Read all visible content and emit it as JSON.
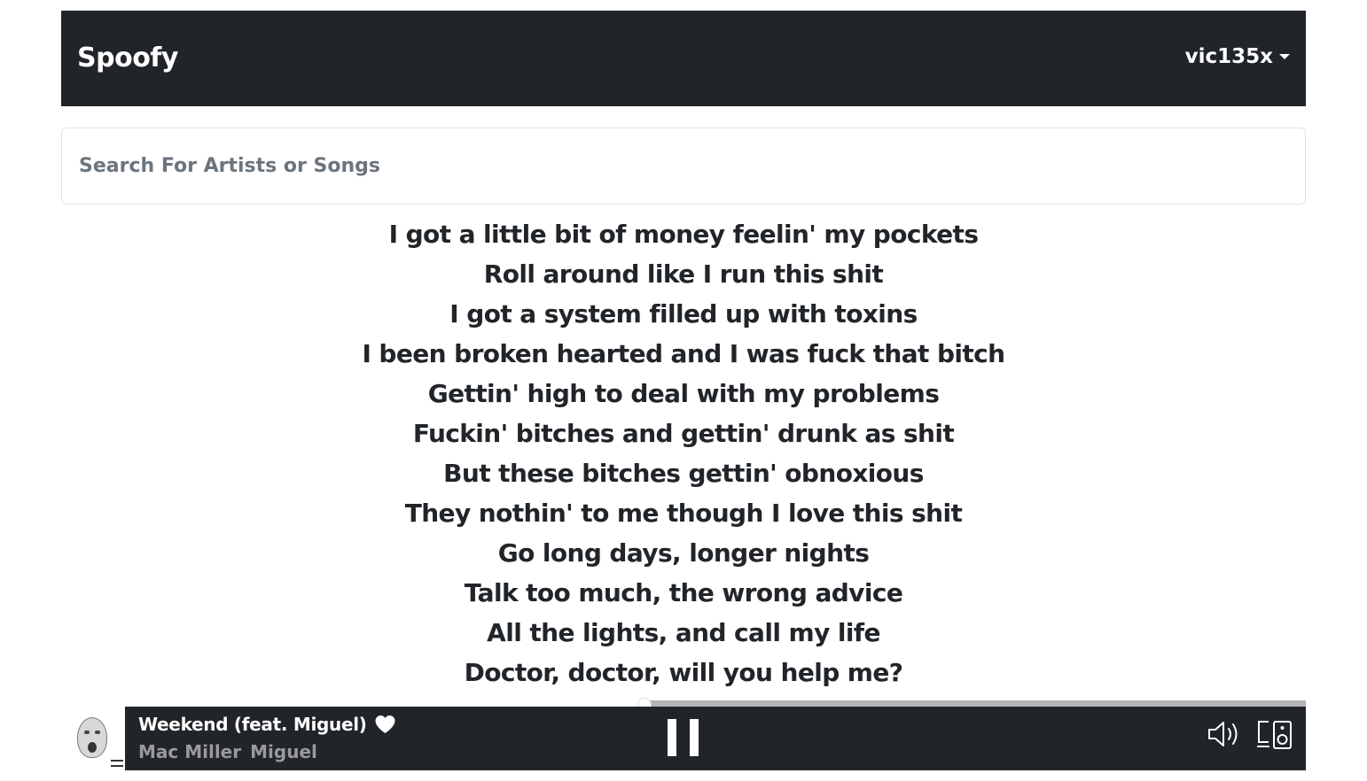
{
  "navbar": {
    "brand": "Spoofy",
    "username": "vic135x"
  },
  "search": {
    "placeholder": "Search For Artists or Songs",
    "value": ""
  },
  "lyrics": [
    "I got a little bit of money feelin' my pockets",
    "Roll around like I run this shit",
    "I got a system filled up with toxins",
    "I been broken hearted and I was fuck that bitch",
    "Gettin' high to deal with my problems",
    "Fuckin' bitches and gettin' drunk as shit",
    "But these bitches gettin' obnoxious",
    "They nothin' to me though I love this shit",
    "Go long days, longer nights",
    "Talk too much, the wrong advice",
    "All the lights, and call my life",
    "Doctor, doctor, will you help me?"
  ],
  "player": {
    "track_title": "Weekend (feat. Miguel)",
    "artists": [
      "Mac Miller",
      "Miguel"
    ],
    "progress_fraction": 0.44,
    "liked": true,
    "is_playing": true,
    "icons": {
      "like": "heart-icon",
      "play_state": "pause-icon",
      "volume": "volume-icon",
      "devices": "device-icon",
      "queue": "menu-icon"
    },
    "colors": {
      "bar_background": "#212529",
      "progress_track": "#b3b3b3",
      "progress_fill": "#ffffff",
      "artist_text": "#9a9a9a"
    }
  }
}
